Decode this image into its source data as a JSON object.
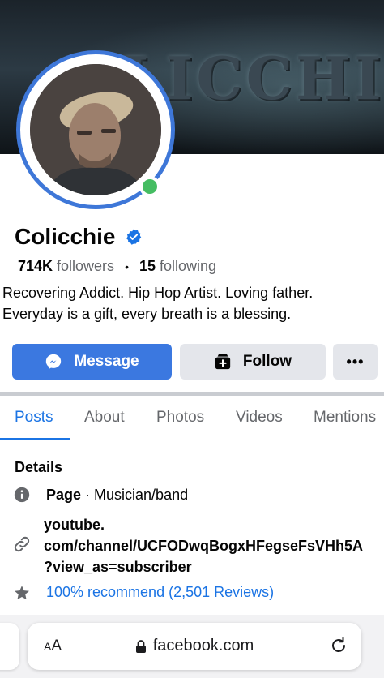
{
  "cover": {
    "text": "LICCHIE"
  },
  "profile": {
    "name": "Colicchie",
    "followers_count": "714K",
    "followers_label": "followers",
    "separator": "•",
    "following_count": "15",
    "following_label": "following",
    "bio_line1": "Recovering Addict. Hip Hop Artist. Loving father.",
    "bio_line2": "Everyday is a gift, every breath is a blessing.",
    "online": true
  },
  "actions": {
    "message_label": "Message",
    "follow_label": "Follow",
    "more_label": "•••"
  },
  "tabs": [
    {
      "label": "Posts",
      "active": true
    },
    {
      "label": "About",
      "active": false
    },
    {
      "label": "Photos",
      "active": false
    },
    {
      "label": "Videos",
      "active": false
    },
    {
      "label": "Mentions",
      "active": false
    }
  ],
  "details": {
    "title": "Details",
    "page_label": "Page",
    "page_category": " · Musician/band",
    "link_line1": "youtube.",
    "link_line2": "com/channel/UCFODwqBogxHFegseFsVHh5A",
    "link_line3": "?view_as=subscriber",
    "recommend": "100% recommend (2,501 Reviews)"
  },
  "browser": {
    "text_size_big": "A",
    "text_size_small": "A",
    "url": "facebook.com"
  },
  "icons": {
    "verified": "verified-badge-icon",
    "messenger": "messenger-icon",
    "follow": "follow-icon",
    "info": "info-icon",
    "link": "link-icon",
    "star": "star-icon",
    "lock": "lock-icon",
    "reload": "reload-icon"
  },
  "colors": {
    "accent": "#1b74e4",
    "message_button": "#3b78e0",
    "secondary_button": "#e4e6eb",
    "online": "#45bd62",
    "avatar_ring": "#3e77d8"
  }
}
